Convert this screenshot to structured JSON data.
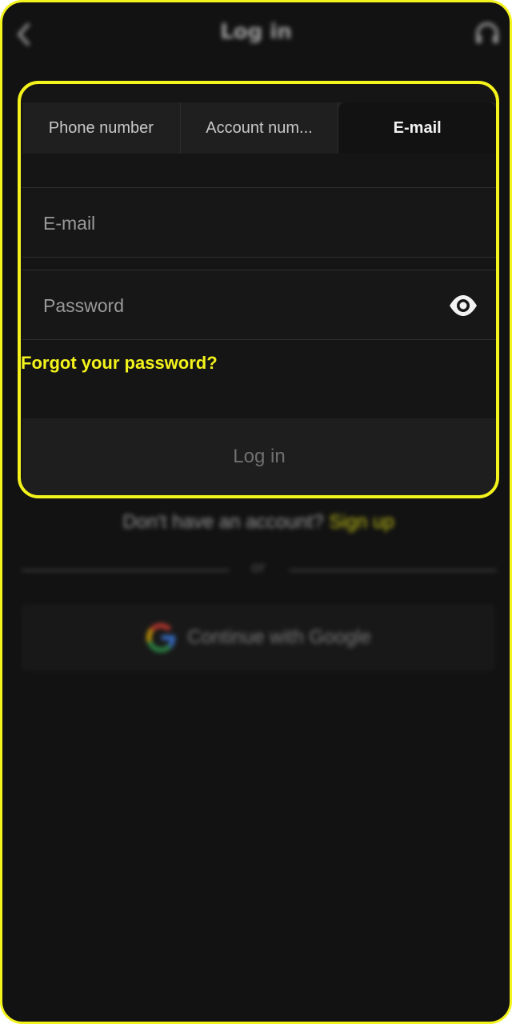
{
  "header": {
    "title": "Log in",
    "back_icon": "chevron-left-icon",
    "support_icon": "headset-icon"
  },
  "login": {
    "tabs": [
      {
        "label": "Phone number",
        "active": false
      },
      {
        "label": "Account num...",
        "active": false
      },
      {
        "label": "E-mail",
        "active": true
      }
    ],
    "email_placeholder": "E-mail",
    "password_placeholder": "Password",
    "password_toggle_icon": "eye-icon",
    "forgot_password": "Forgot your password?",
    "submit_label": "Log in"
  },
  "signup": {
    "prompt": "Don't have an account?",
    "link": "Sign up"
  },
  "divider": {
    "text": "or"
  },
  "google": {
    "label": "Continue with Google",
    "icon": "google-icon"
  },
  "colors": {
    "accent": "#f4f31c",
    "background": "#121212",
    "field": "#171717",
    "tab_bar": "#1f1f1f"
  }
}
